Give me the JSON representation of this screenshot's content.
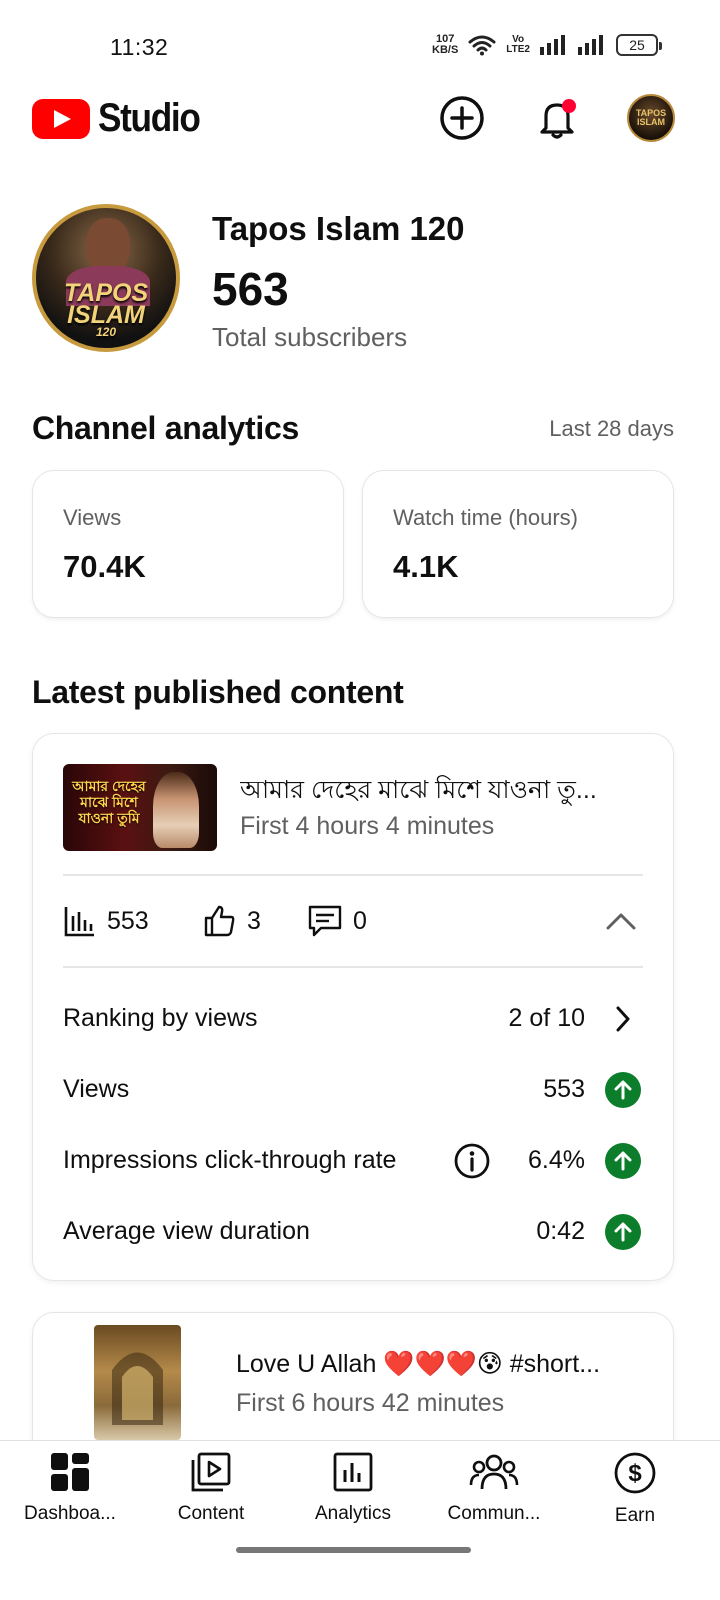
{
  "status_bar": {
    "time": "11:32",
    "net_speed_value": "107",
    "net_speed_unit": "KB/S",
    "volte_top": "Vo",
    "volte_bottom": "LTE2",
    "battery": "25"
  },
  "app_bar": {
    "logo_text": "Studio",
    "icons": [
      "create-icon",
      "notifications-icon",
      "account-avatar"
    ],
    "avatar_text": "TAPOS ISLAM"
  },
  "channel": {
    "name": "Tapos Islam 120",
    "subscribers": "563",
    "subscribers_label": "Total subscribers",
    "avatar_brand_line1": "TAPOS",
    "avatar_brand_line2": "ISLAM",
    "avatar_brand_line3": "120"
  },
  "analytics": {
    "title": "Channel analytics",
    "period": "Last 28 days",
    "cards": [
      {
        "label": "Views",
        "value": "70.4K"
      },
      {
        "label": "Watch time (hours)",
        "value": "4.1K"
      }
    ]
  },
  "latest": {
    "title": "Latest published content",
    "video": {
      "title": "আমার দেহের মাঝে মিশে যাওনা তু...",
      "subtitle": "First 4 hours 4 minutes",
      "thumb_text": "আমার দেহের মাঝে মিশে যাওনা তুমি",
      "views": "553",
      "likes": "3",
      "comments": "0",
      "rows": [
        {
          "label": "Ranking by views",
          "value": "2 of 10"
        },
        {
          "label": "Views",
          "value": "553"
        },
        {
          "label": "Impressions click-through rate",
          "value": "6.4%"
        },
        {
          "label": "Average view duration",
          "value": "0:42"
        }
      ]
    },
    "video2": {
      "title": "Love U Allah ❤️❤️❤️😰 #short...",
      "subtitle": "First 6 hours 42 minutes"
    }
  },
  "bottom_nav": [
    {
      "label": "Dashboa..."
    },
    {
      "label": "Content"
    },
    {
      "label": "Analytics"
    },
    {
      "label": "Commun..."
    },
    {
      "label": "Earn"
    }
  ],
  "colors": {
    "brand_red": "#ff0000",
    "positive_green": "#0b7d2b",
    "secondary_text": "#606060",
    "notification_dot": "#ff0033"
  }
}
